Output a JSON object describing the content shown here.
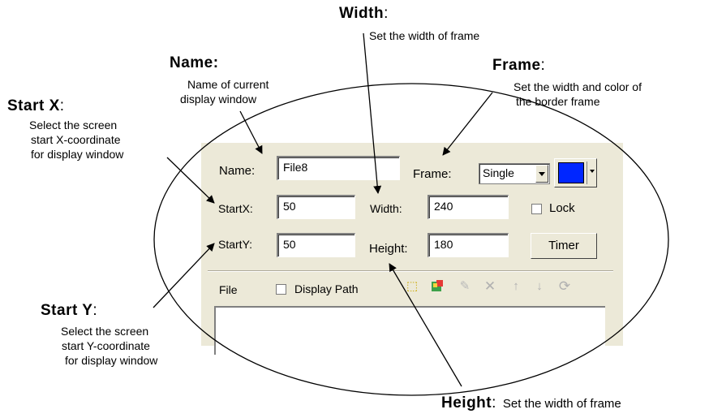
{
  "form": {
    "name_label": "Name:",
    "name_value": "File8",
    "frame_label": "Frame:",
    "frame_option": "Single",
    "frame_color": "#0026ff",
    "startx_label": "StartX:",
    "startx_value": "50",
    "width_label": "Width:",
    "width_value": "240",
    "lock_label": "Lock",
    "starty_label": "StartY:",
    "starty_value": "50",
    "height_label": "Height:",
    "height_value": "180",
    "timer_label": "Timer",
    "file_label": "File",
    "display_path_label": "Display Path"
  },
  "toolbar": {
    "icons": [
      "new-icon",
      "add-icon",
      "edit-icon",
      "delete-icon",
      "move-up-icon",
      "move-down-icon",
      "refresh-icon"
    ]
  },
  "annotations": {
    "width": {
      "title": "Width",
      "desc": "Set the width of frame"
    },
    "name": {
      "title": "Name:",
      "desc1": "Name of current",
      "desc2": "display window"
    },
    "frame": {
      "title": "Frame",
      "desc1": "Set the width and color of",
      "desc2": "the border frame"
    },
    "startx": {
      "title": "Start X",
      "desc1": "Select the screen",
      "desc2": "start X-coordinate",
      "desc3": "for display window"
    },
    "starty": {
      "title": "Start Y",
      "desc1": "Select the screen",
      "desc2": "start Y-coordinate",
      "desc3": "for display window"
    },
    "height": {
      "title": "Height",
      "desc": "Set the width of frame"
    }
  }
}
